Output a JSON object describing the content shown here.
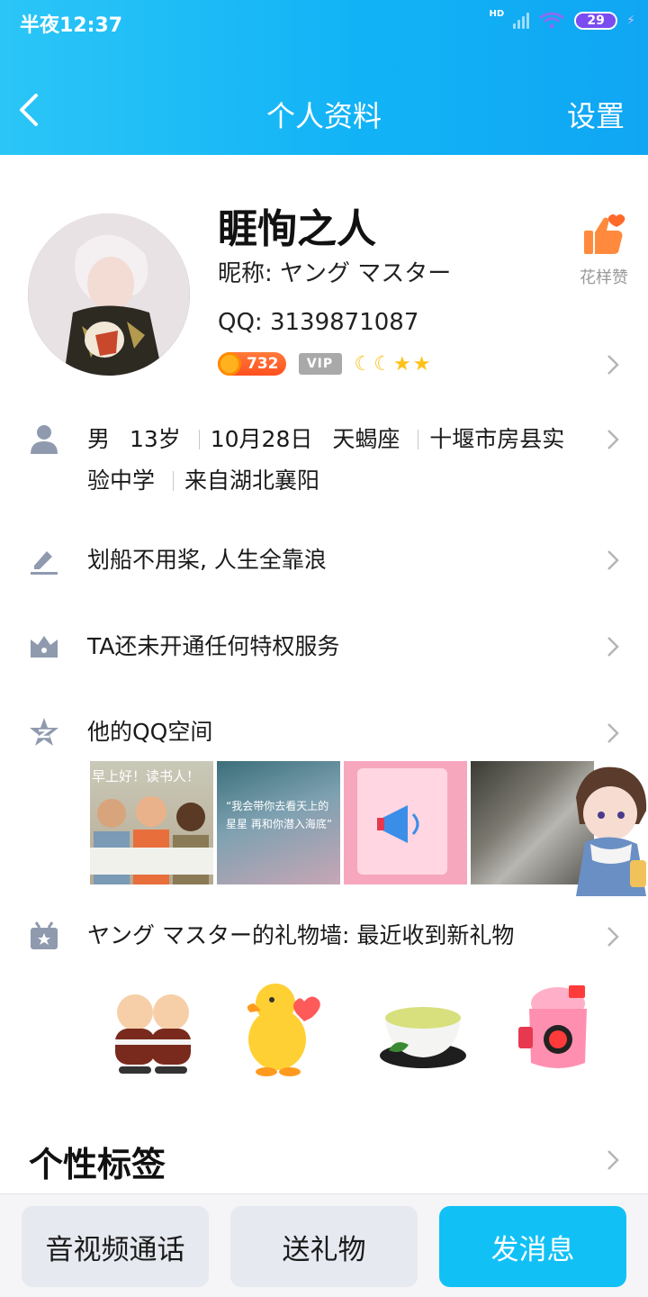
{
  "status_bar": {
    "time": "半夜12:37",
    "network_label": "HD",
    "battery": "29"
  },
  "nav": {
    "title": "个人资料",
    "settings_label": "设置"
  },
  "profile": {
    "name": "睚恂之人",
    "nickname": "昵称: ヤング マスター",
    "qq": "QQ: 3139871087",
    "coin_count": "732",
    "vip_label": "VIP",
    "level_icons": [
      "moon",
      "moon",
      "star",
      "star"
    ],
    "like_label": "花样赞"
  },
  "info": {
    "gender": "男",
    "age": "13岁",
    "birthday": "10月28日",
    "zodiac": "天蝎座",
    "school_part1": "十堰市房县实",
    "school_part2": "验中学",
    "hometown": "来自湖北襄阳"
  },
  "signature": "划船不用桨, 人生全靠浪",
  "privilege": "TA还未开通任何特权服务",
  "qzone": {
    "label": "他的QQ空间",
    "photos": [
      {
        "text": "早上好！读书人！"
      },
      {
        "text": "“我会带你去看天上的星星 再和你潜入海底”"
      },
      {
        "text": ""
      },
      {
        "text": ""
      }
    ]
  },
  "gift_wall": {
    "label": "ヤング マスター的礼物墙: 最近收到新礼物",
    "gifts": [
      "twin-pigs-icon",
      "duck-heart-icon",
      "tea-cup-icon",
      "pink-jar-icon"
    ]
  },
  "tags_title": "个性标签",
  "actions": {
    "call": "音视频通话",
    "gift": "送礼物",
    "message": "发消息"
  },
  "colors": {
    "header": "#12b3f6",
    "message_button": "#11c1f6",
    "coin_badge": "#ff4f1f"
  }
}
